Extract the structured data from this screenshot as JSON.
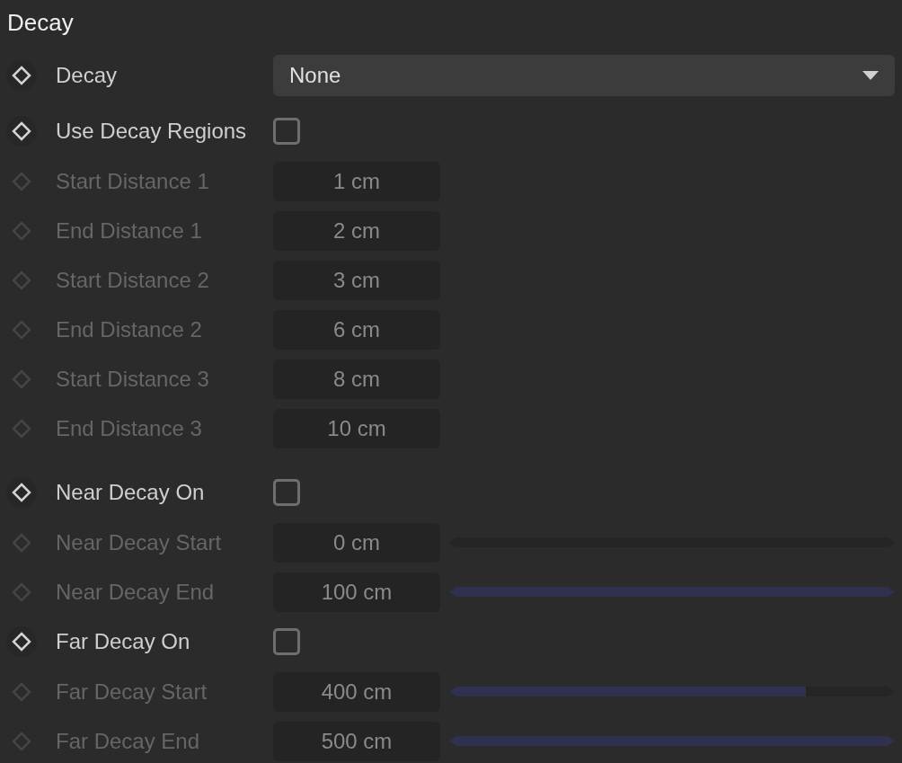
{
  "section": {
    "title": "Decay"
  },
  "rows": [
    {
      "kind": "dropdown",
      "label": "Decay",
      "value": "None",
      "disabled": false
    },
    {
      "kind": "checkbox",
      "label": "Use Decay Regions",
      "checked": false,
      "disabled": false
    },
    {
      "kind": "number",
      "label": "Start Distance 1",
      "value": "1 cm",
      "disabled": true
    },
    {
      "kind": "number",
      "label": "End Distance 1",
      "value": "2 cm",
      "disabled": true
    },
    {
      "kind": "number",
      "label": "Start Distance 2",
      "value": "3 cm",
      "disabled": true
    },
    {
      "kind": "number",
      "label": "End Distance 2",
      "value": "6 cm",
      "disabled": true
    },
    {
      "kind": "number",
      "label": "Start Distance 3",
      "value": "8 cm",
      "disabled": true
    },
    {
      "kind": "number",
      "label": "End Distance 3",
      "value": "10 cm",
      "disabled": true
    },
    {
      "kind": "checkbox",
      "label": "Near Decay On",
      "checked": false,
      "disabled": false
    },
    {
      "kind": "slider",
      "label": "Near Decay Start",
      "value": "0 cm",
      "level": 0,
      "disabled": true
    },
    {
      "kind": "slider",
      "label": "Near Decay End",
      "value": "100 cm",
      "level": 1,
      "disabled": true
    },
    {
      "kind": "checkbox",
      "label": "Far Decay On",
      "checked": false,
      "disabled": false
    },
    {
      "kind": "slider",
      "label": "Far Decay Start",
      "value": "400 cm",
      "level": 0.8,
      "disabled": true
    },
    {
      "kind": "slider",
      "label": "Far Decay End",
      "value": "500 cm",
      "level": 1,
      "disabled": true
    }
  ]
}
